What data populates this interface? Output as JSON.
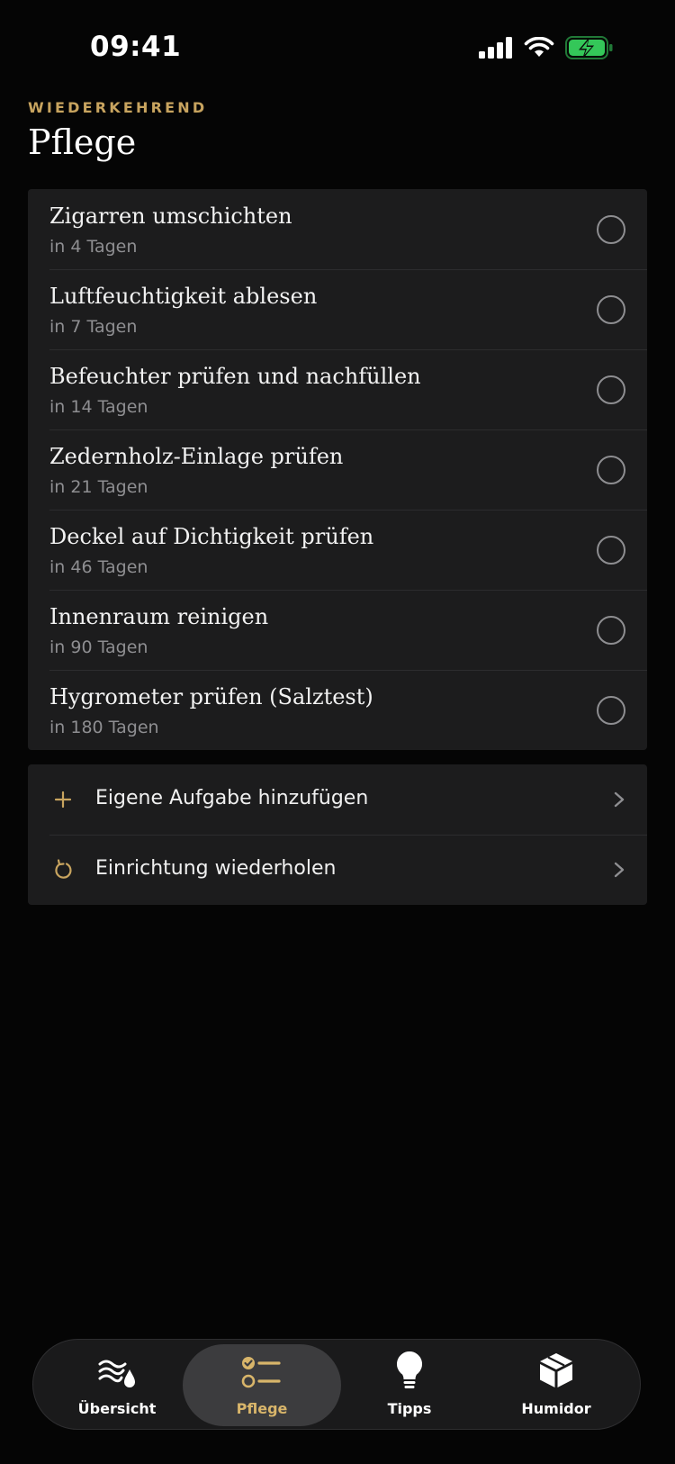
{
  "status_bar": {
    "time": "09:41"
  },
  "header": {
    "eyebrow": "WIEDERKEHREND",
    "title": "Pflege"
  },
  "tasks": [
    {
      "title": "Zigarren umschichten",
      "due": "in 4 Tagen"
    },
    {
      "title": "Luftfeuchtigkeit ablesen",
      "due": "in 7 Tagen"
    },
    {
      "title": "Befeuchter prüfen und nachfüllen",
      "due": "in 14 Tagen"
    },
    {
      "title": "Zedernholz-Einlage prüfen",
      "due": "in 21 Tagen"
    },
    {
      "title": "Deckel auf Dichtigkeit prüfen",
      "due": "in 46 Tagen"
    },
    {
      "title": "Innenraum reinigen",
      "due": "in 90 Tagen"
    },
    {
      "title": "Hygrometer prüfen (Salztest)",
      "due": "in 180 Tagen"
    }
  ],
  "actions": [
    {
      "label": "Eigene Aufgabe hinzufügen",
      "icon": "plus-icon"
    },
    {
      "label": "Einrichtung wiederholen",
      "icon": "restart-icon"
    }
  ],
  "tabs": [
    {
      "label": "Übersicht",
      "icon": "waves-drop-icon",
      "active": false
    },
    {
      "label": "Pflege",
      "icon": "checklist-icon",
      "active": true
    },
    {
      "label": "Tipps",
      "icon": "lightbulb-icon",
      "active": false
    },
    {
      "label": "Humidor",
      "icon": "box-icon",
      "active": false
    }
  ],
  "colors": {
    "accent": "#c8a45f",
    "battery": "#34c759",
    "background": "#050505",
    "card": "#1c1c1d"
  }
}
